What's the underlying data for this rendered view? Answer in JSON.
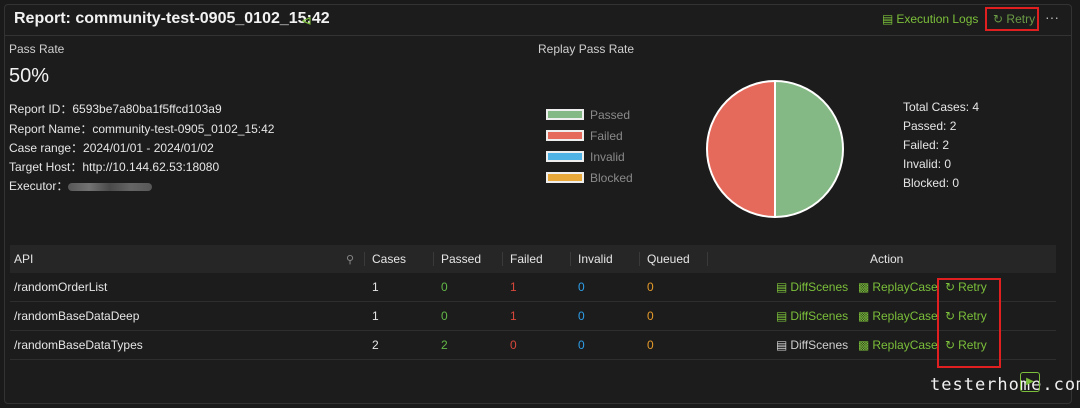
{
  "header": {
    "title": "Report: community-test-0905_0102_15:42",
    "execution_logs": "Execution Logs",
    "retry": "Retry",
    "more": "···"
  },
  "summary": {
    "pass_rate_label": "Pass Rate",
    "pass_rate_value": "50%",
    "report_id": "Report ID：6593be7a80ba1f5ffcd103a9",
    "report_name": "Report Name：community-test-0905_0102_15:42",
    "case_range": "Case range：2024/01/01 - 2024/01/02",
    "target_host": "Target Host：http://10.144.62.53:18080",
    "executor_label": "Executor："
  },
  "chart_section": {
    "label": "Replay Pass Rate",
    "legend": [
      {
        "label": "Passed",
        "color": "#84b884"
      },
      {
        "label": "Failed",
        "color": "#e66a5b"
      },
      {
        "label": "Invalid",
        "color": "#4fb3e6"
      },
      {
        "label": "Blocked",
        "color": "#e8a83a"
      }
    ],
    "totals": {
      "total": "Total Cases: 4",
      "passed": "Passed: 2",
      "failed": "Failed: 2",
      "invalid": "Invalid: 0",
      "blocked": "Blocked: 0"
    }
  },
  "chart_data": {
    "type": "pie",
    "categories": [
      "Passed",
      "Failed",
      "Invalid",
      "Blocked"
    ],
    "values": [
      2,
      2,
      0,
      0
    ],
    "colors": [
      "#84b884",
      "#e66a5b",
      "#4fb3e6",
      "#e8a83a"
    ]
  },
  "table": {
    "columns": [
      "API",
      "Cases",
      "Passed",
      "Failed",
      "Invalid",
      "Queued",
      "Action"
    ],
    "rows": [
      {
        "api": "/randomOrderList",
        "cases": "1",
        "passed": "0",
        "failed": "1",
        "invalid": "0",
        "queued": "0",
        "diff": "DiffScenes",
        "replay": "ReplayCase",
        "retry": "Retry"
      },
      {
        "api": "/randomBaseDataDeep",
        "cases": "1",
        "passed": "0",
        "failed": "1",
        "invalid": "0",
        "queued": "0",
        "diff": "DiffScenes",
        "replay": "ReplayCase",
        "retry": "Retry"
      },
      {
        "api": "/randomBaseDataTypes",
        "cases": "2",
        "passed": "2",
        "failed": "0",
        "invalid": "0",
        "queued": "0",
        "diff": "DiffScenes",
        "replay": "ReplayCase",
        "retry": "Retry"
      }
    ]
  },
  "watermark": "testerhome.com"
}
